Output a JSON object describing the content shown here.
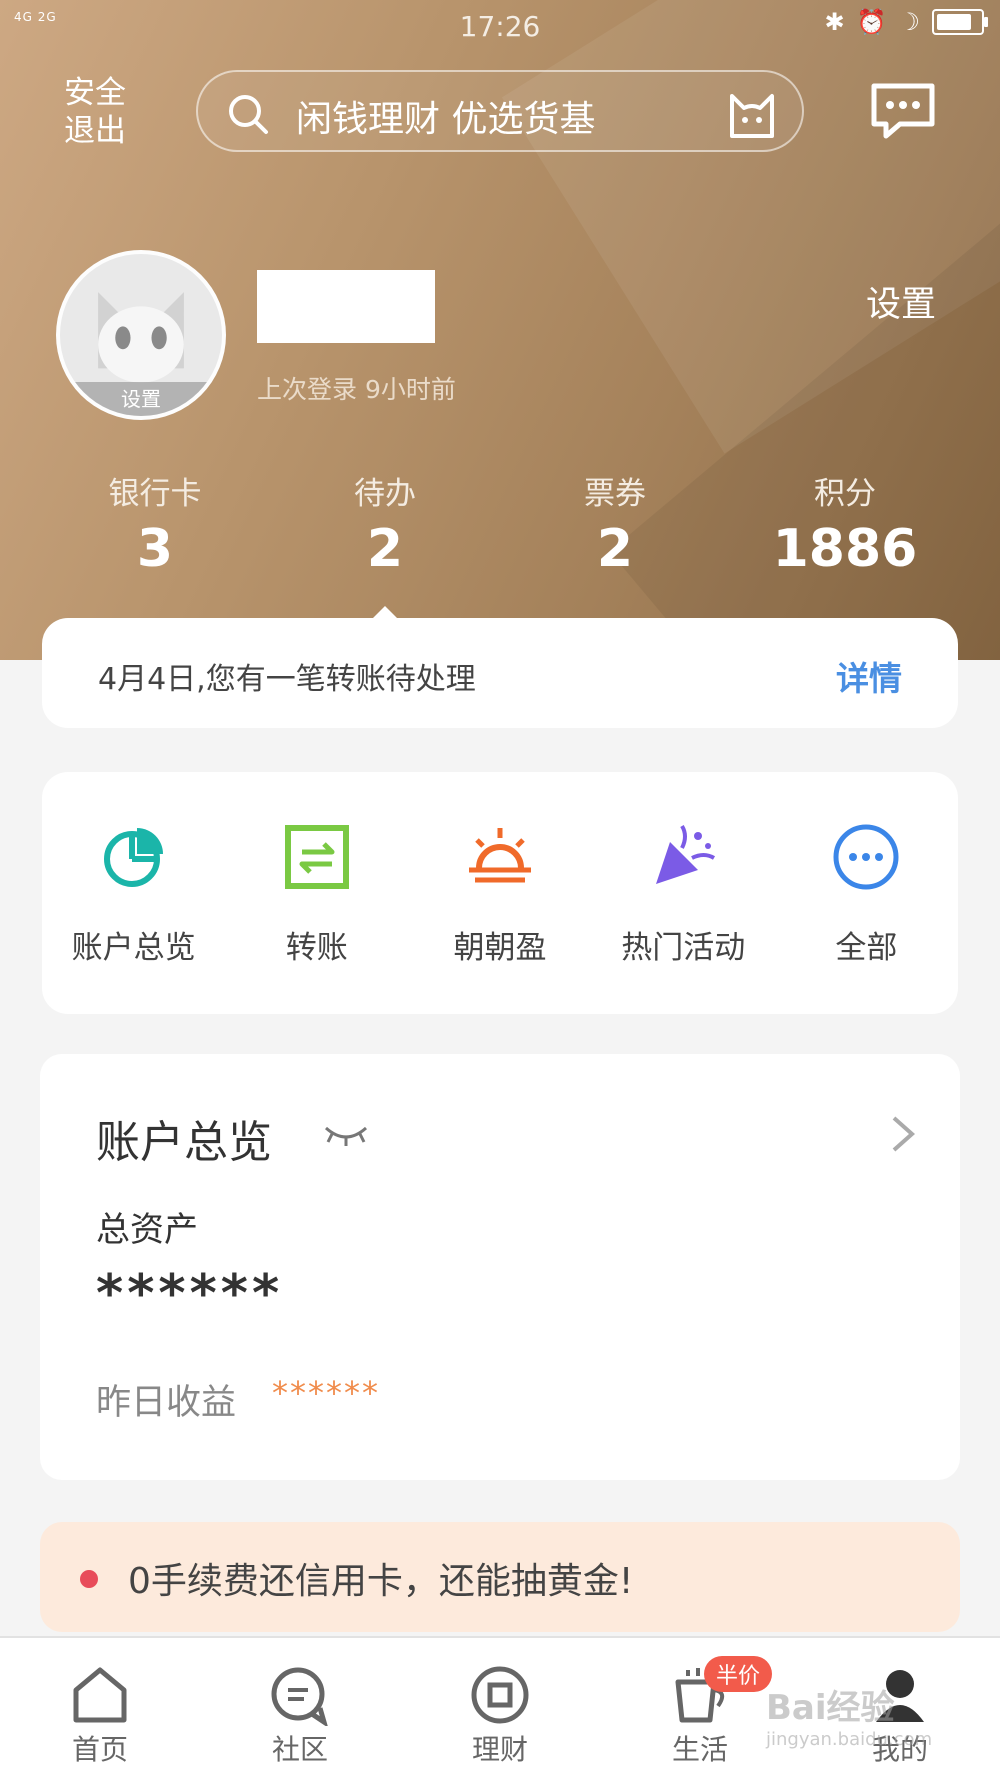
{
  "status_bar": {
    "network": "4G 2G",
    "time": "17:26"
  },
  "header": {
    "logout_label": "安全\n退出",
    "search_placeholder": "闲钱理财 优选货基"
  },
  "profile": {
    "avatar_tag": "设置",
    "last_login": "上次登录 9小时前",
    "settings_label": "设置"
  },
  "stats": [
    {
      "label": "银行卡",
      "value": "3"
    },
    {
      "label": "待办",
      "value": "2"
    },
    {
      "label": "票券",
      "value": "2"
    },
    {
      "label": "积分",
      "value": "1886"
    }
  ],
  "notice": {
    "text": "4月4日,您有一笔转账待处理",
    "detail_label": "详情"
  },
  "shortcuts": [
    {
      "label": "账户总览",
      "icon": "pie-chart-icon",
      "color": "#1bb5a9"
    },
    {
      "label": "转账",
      "icon": "transfer-icon",
      "color": "#7ac943"
    },
    {
      "label": "朝朝盈",
      "icon": "sunrise-icon",
      "color": "#f06a2a"
    },
    {
      "label": "热门活动",
      "icon": "party-popper-icon",
      "color": "#7b5be6"
    },
    {
      "label": "全部",
      "icon": "more-icon",
      "color": "#3b86e8"
    }
  ],
  "overview": {
    "title": "账户总览",
    "total_assets_label": "总资产",
    "total_assets_value": "******",
    "yesterday_label": "昨日收益",
    "yesterday_value": "******"
  },
  "promo": {
    "text": "0手续费还信用卡，还能抽黄金!"
  },
  "tabbar": [
    {
      "label": "首页",
      "icon": "home-icon"
    },
    {
      "label": "社区",
      "icon": "chat-bubble-icon"
    },
    {
      "label": "理财",
      "icon": "wealth-icon"
    },
    {
      "label": "生活",
      "icon": "coffee-cup-icon",
      "badge": "半价"
    },
    {
      "label": "我的",
      "icon": "user-icon"
    }
  ],
  "watermark": {
    "text": "Bai经验",
    "sub": "jingyan.baidu.com"
  },
  "colors": {
    "accent_blue": "#4a8fe2",
    "hero_brown": "#b8946c",
    "promo_bg": "#fdeadc"
  }
}
